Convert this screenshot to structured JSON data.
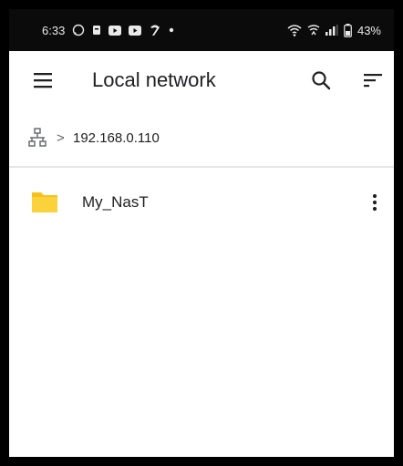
{
  "status_bar": {
    "time": "6:33",
    "battery": "43%",
    "icons": [
      "whatsapp-icon",
      "notification-icon",
      "youtube-icon",
      "youtube-icon",
      "app-icon",
      "dot-icon",
      "wifi-icon",
      "wifi-calling-icon",
      "signal-icon",
      "battery-icon"
    ]
  },
  "app_bar": {
    "title": "Local network",
    "icons": [
      "menu-icon",
      "search-icon",
      "sort-icon"
    ]
  },
  "breadcrumb": {
    "icon": "network-icon",
    "separator": ">",
    "path": "192.168.0.110"
  },
  "files": [
    {
      "name": "My_NasT",
      "icon": "folder-icon",
      "menu_icon": "more-vert-icon"
    }
  ],
  "colors": {
    "status_bar_bg": "#0b0b0b",
    "background": "#ffffff",
    "text": "#202124",
    "folder": "#F6C21A",
    "divider": "#e6e6e6"
  }
}
